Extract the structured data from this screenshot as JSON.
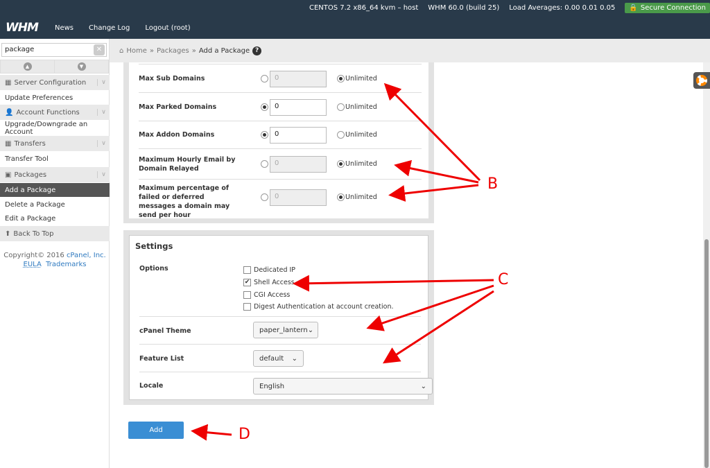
{
  "top": {
    "os": "CENTOS 7.2 x86_64 kvm – host",
    "version": "WHM 60.0 (build 25)",
    "load": "Load Averages: 0.00 0.01 0.05",
    "secure": "Secure Connection",
    "logo": "WHM",
    "nav": [
      "News",
      "Change Log",
      "Logout (root)"
    ]
  },
  "sidebar": {
    "search": "package",
    "items": [
      {
        "label": "Server Configuration",
        "type": "cat"
      },
      {
        "label": "Update Preferences",
        "type": "link"
      },
      {
        "label": "Account Functions",
        "type": "cat"
      },
      {
        "label": "Upgrade/Downgrade an Account",
        "type": "link"
      },
      {
        "label": "Transfers",
        "type": "cat"
      },
      {
        "label": "Transfer Tool",
        "type": "link"
      },
      {
        "label": "Packages",
        "type": "cat"
      },
      {
        "label": "Add a Package",
        "type": "active"
      },
      {
        "label": "Delete a Package",
        "type": "link"
      },
      {
        "label": "Edit a Package",
        "type": "link"
      },
      {
        "label": "Back To Top",
        "type": "cat"
      }
    ],
    "copyright": "Copyright© 2016",
    "company": "cPanel, Inc.",
    "eula": "EULA",
    "trademarks": "Trademarks"
  },
  "breadcrumb": {
    "home": "Home",
    "sep": "»",
    "packages": "Packages",
    "current": "Add a Package"
  },
  "limits": {
    "unlimited": "Unlimited",
    "rows": [
      {
        "label": "Max Sub Domains",
        "value": "0",
        "unlimited": true
      },
      {
        "label": "Max Parked Domains",
        "value": "0",
        "unlimited": false
      },
      {
        "label": "Max Addon Domains",
        "value": "0",
        "unlimited": false
      },
      {
        "label": "Maximum Hourly Email by Domain Relayed",
        "value": "0",
        "unlimited": true
      },
      {
        "label": "Maximum percentage of failed or deferred messages a domain may send per hour",
        "value": "0",
        "unlimited": true
      }
    ]
  },
  "settings": {
    "title": "Settings",
    "options_label": "Options",
    "options": [
      {
        "label": "Dedicated IP",
        "checked": false
      },
      {
        "label": "Shell Access",
        "checked": true
      },
      {
        "label": "CGI Access",
        "checked": false
      },
      {
        "label": "Digest Authentication at account creation.",
        "checked": false
      }
    ],
    "theme_label": "cPanel Theme",
    "theme": "paper_lantern",
    "feature_label": "Feature List",
    "feature": "default",
    "locale_label": "Locale",
    "locale": "English"
  },
  "add_label": "Add",
  "annotations": {
    "b": "B",
    "c": "C",
    "d": "D",
    "color": "#e00000"
  }
}
